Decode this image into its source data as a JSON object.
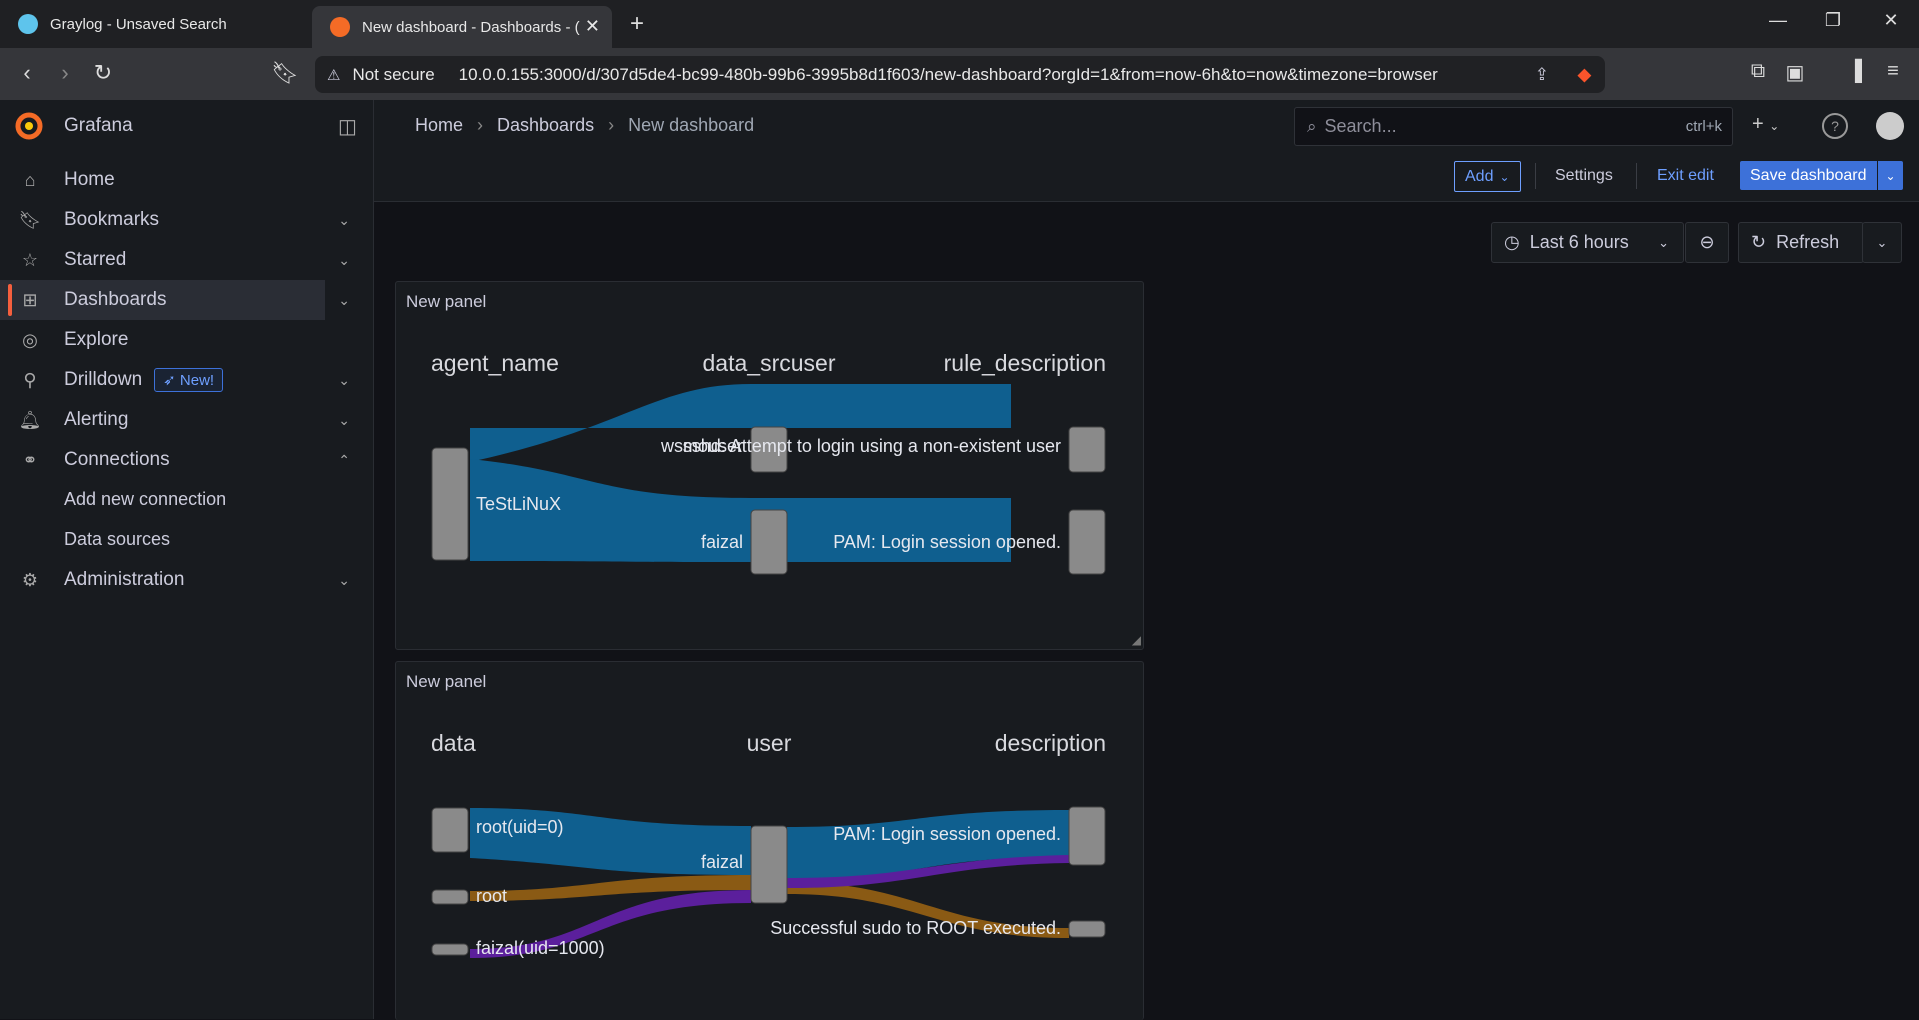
{
  "browser": {
    "tabs": [
      {
        "title": "Graylog - Unsaved Search",
        "active": false
      },
      {
        "title": "New dashboard - Dashboards - (",
        "active": true
      }
    ],
    "security_label": "Not secure",
    "url": "10.0.0.155:3000/d/307d5de4-bc99-480b-99b6-3995b8d1f603/new-dashboard?orgId=1&from=now-6h&to=now&timezone=browser"
  },
  "app": {
    "name": "Grafana"
  },
  "breadcrumb": [
    "Home",
    "Dashboards",
    "New dashboard"
  ],
  "search": {
    "placeholder": "Search...",
    "shortcut": "ctrl+k"
  },
  "sidebar": {
    "items": [
      {
        "label": "Home",
        "icon": "home-icon",
        "chevron": ""
      },
      {
        "label": "Bookmarks",
        "icon": "bookmark-icon",
        "chevron": "down"
      },
      {
        "label": "Starred",
        "icon": "star-icon",
        "chevron": "down"
      },
      {
        "label": "Dashboards",
        "icon": "apps-icon",
        "chevron": "down",
        "active": true
      },
      {
        "label": "Explore",
        "icon": "compass-icon",
        "chevron": ""
      },
      {
        "label": "Drilldown",
        "icon": "microscope-icon",
        "chevron": "down",
        "badge": "New!"
      },
      {
        "label": "Alerting",
        "icon": "bell-icon",
        "chevron": "down"
      },
      {
        "label": "Connections",
        "icon": "link-icon",
        "chevron": "up"
      },
      {
        "label": "Add new connection",
        "sub": true
      },
      {
        "label": "Data sources",
        "sub": true
      },
      {
        "label": "Administration",
        "icon": "cog-icon",
        "chevron": "down"
      }
    ]
  },
  "toolbar": {
    "add_label": "Add",
    "settings_label": "Settings",
    "exit_label": "Exit edit",
    "save_label": "Save dashboard"
  },
  "time_picker": {
    "label": "Last 6 hours"
  },
  "refresh": {
    "label": "Refresh"
  },
  "panels": [
    {
      "title": "New panel",
      "columns": [
        "agent_name",
        "data_srcuser",
        "rule_description"
      ],
      "nodes": {
        "agent": [
          "TeStLiNuX"
        ],
        "srcuser": [
          "wsmouser",
          "faizal"
        ],
        "rule": [
          "sshd: Attempt to login using a non-existent user",
          "PAM: Login session opened."
        ]
      },
      "flows": [
        {
          "from": "TeStLiNuX",
          "to": "wsmouser",
          "color": "#0f5f8f"
        },
        {
          "from": "TeStLiNuX",
          "to": "faizal",
          "color": "#0f5f8f"
        }
      ]
    },
    {
      "title": "New panel",
      "columns": [
        "data",
        "user",
        "description"
      ],
      "nodes": {
        "data": [
          "root(uid=0)",
          "root",
          "faizal(uid=1000)"
        ],
        "user": [
          "faizal"
        ],
        "description": [
          "PAM: Login session opened.",
          "Successful sudo to ROOT executed."
        ]
      },
      "flow_colors": {
        "blue": "#0f5f8f",
        "orange": "#8a5a14",
        "purple": "#5b1f9c"
      }
    }
  ]
}
